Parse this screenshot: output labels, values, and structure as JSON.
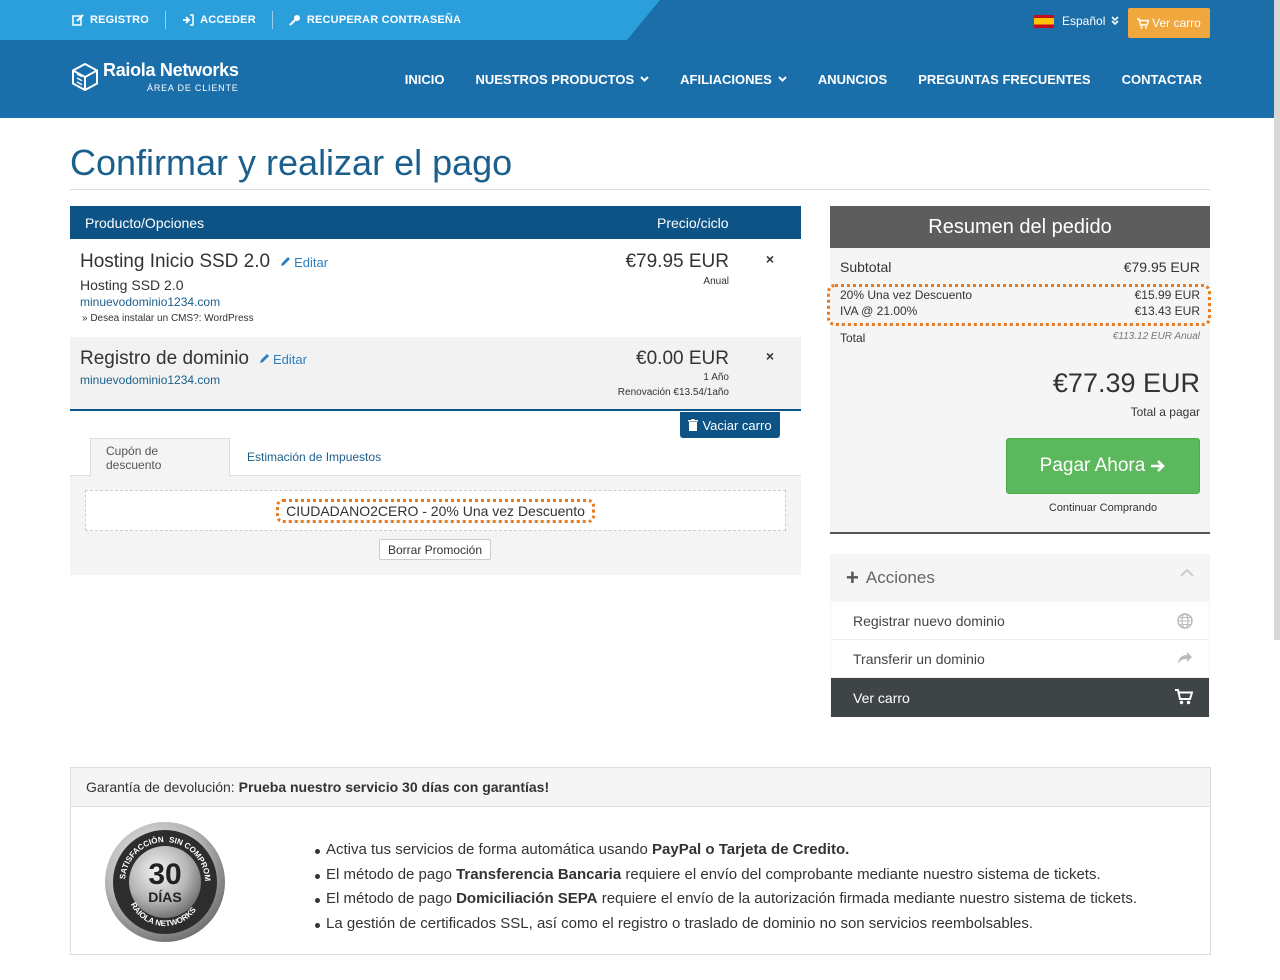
{
  "topbar": {
    "links": [
      "REGISTRO",
      "ACCEDER",
      "RECUPERAR CONTRASEÑA"
    ],
    "language": "Español",
    "cart_button": "Ver carro"
  },
  "logo": {
    "name": "Raiola Networks",
    "subtitle": "ÁREA DE CLIENTE"
  },
  "nav": [
    "INICIO",
    "NUESTROS PRODUCTOS",
    "AFILIACIONES",
    "ANUNCIOS",
    "PREGUNTAS FRECUENTES",
    "CONTACTAR"
  ],
  "page_title": "Confirmar y realizar el pago",
  "table": {
    "col_product": "Producto/Opciones",
    "col_price": "Precio/ciclo",
    "items": [
      {
        "name": "Hosting Inicio SSD 2.0",
        "edit": "Editar",
        "subtitle": "Hosting SSD 2.0",
        "domain": "minuevodominio1234.com",
        "option": "» Desea instalar un CMS?: WordPress",
        "price": "€79.95 EUR",
        "cycle": "Anual"
      },
      {
        "name": "Registro de dominio",
        "edit": "Editar",
        "domain": "minuevodominio1234.com",
        "price": "€0.00 EUR",
        "cycle": "1 Año",
        "renewal": "Renovación €13.54/1año"
      }
    ],
    "remove_symbol": "×",
    "empty_cart": "Vaciar carro"
  },
  "coupon": {
    "tab_coupon": "Cupón de descuento",
    "tab_tax": "Estimación de Impuestos",
    "applied": "CIUDADANO2CERO - 20% Una vez Descuento",
    "remove": "Borrar Promoción"
  },
  "summary": {
    "title": "Resumen del pedido",
    "subtotal_label": "Subtotal",
    "subtotal_value": "€79.95 EUR",
    "discount_label": "20% Una vez Descuento",
    "discount_value": "€15.99 EUR",
    "tax_label": "IVA @ 21.00%",
    "tax_value": "€13.43 EUR",
    "total_label": "Total",
    "total_recurring": "€113.12 EUR Anual",
    "total_amount": "€77.39 EUR",
    "total_to_pay": "Total a pagar",
    "pay_button": "Pagar Ahora",
    "continue": "Continuar Comprando"
  },
  "actions": {
    "title": "Acciones",
    "items": [
      "Registrar nuevo dominio",
      "Transferir un dominio",
      "Ver carro"
    ]
  },
  "guarantee": {
    "label": "Garantía de devolución:",
    "headline": "Prueba nuestro servicio 30 días con garantías!",
    "seal": {
      "top_left": "SATISFACCIÓN 100%",
      "top_right": "SIN COMPROMISOS",
      "number": "30",
      "days": "DÍAS",
      "bottom": "RAIOLA NETWORKS"
    },
    "bullets": [
      {
        "pre": "Activa tus servicios de forma automática usando ",
        "bold": "PayPal o Tarjeta de Credito.",
        "post": ""
      },
      {
        "pre": "El método de pago ",
        "bold": "Transferencia Bancaria",
        "post": " requiere el envío del comprobante mediante nuestro sistema de tickets."
      },
      {
        "pre": "El método de pago ",
        "bold": "Domiciliación SEPA",
        "post": " requiere el envío de la autorización firmada mediante nuestro sistema de tickets."
      },
      {
        "pre": "La gestión de certificados SSL, así como el registro o traslado de dominio no son servicios reembolsables.",
        "bold": "",
        "post": ""
      }
    ]
  },
  "colors": {
    "brand_blue": "#1a6eaa",
    "table_header": "#0d5386",
    "cart_orange": "#f0a83e",
    "pay_green": "#5cb85c",
    "highlight_orange": "#e87a1e"
  }
}
